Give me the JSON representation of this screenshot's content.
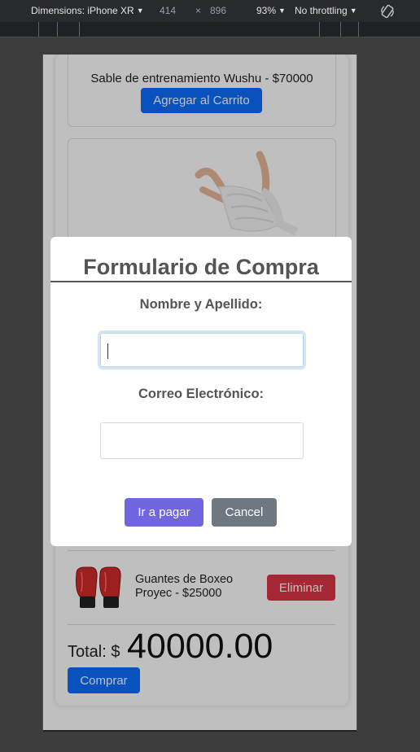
{
  "devtools": {
    "device_label": "Dimensions: iPhone XR",
    "width": "414",
    "times": "×",
    "height": "896",
    "zoom": "93%",
    "throttling": "No throttling",
    "rotate_icon": "rotate-icon"
  },
  "page": {
    "product_top": {
      "title": "Sable de entrenamiento Wushu - $70000",
      "add_button": "Agregar al Carrito"
    },
    "product_second": {
      "image_icon": "hand-wraps-image"
    },
    "cart": {
      "item": {
        "name_line1": "Guantes de Boxeo",
        "name_line2": "Proyec - $25000",
        "remove_button": "Eliminar",
        "image_icon": "boxing-gloves-image"
      },
      "total_label": "Total: $",
      "total_value": "40000.00",
      "buy_button": "Comprar"
    }
  },
  "modal": {
    "title": "Formulario de Compra",
    "name_label": "Nombre y Apellido:",
    "name_value": "",
    "email_label": "Correo Electrónico:",
    "email_value": "",
    "confirm_button": "Ir a pagar",
    "cancel_button": "Cancel"
  },
  "colors": {
    "primary": "#0d6efd",
    "danger": "#dc3545",
    "confirm": "#7066e0",
    "cancel": "#6e7881"
  }
}
